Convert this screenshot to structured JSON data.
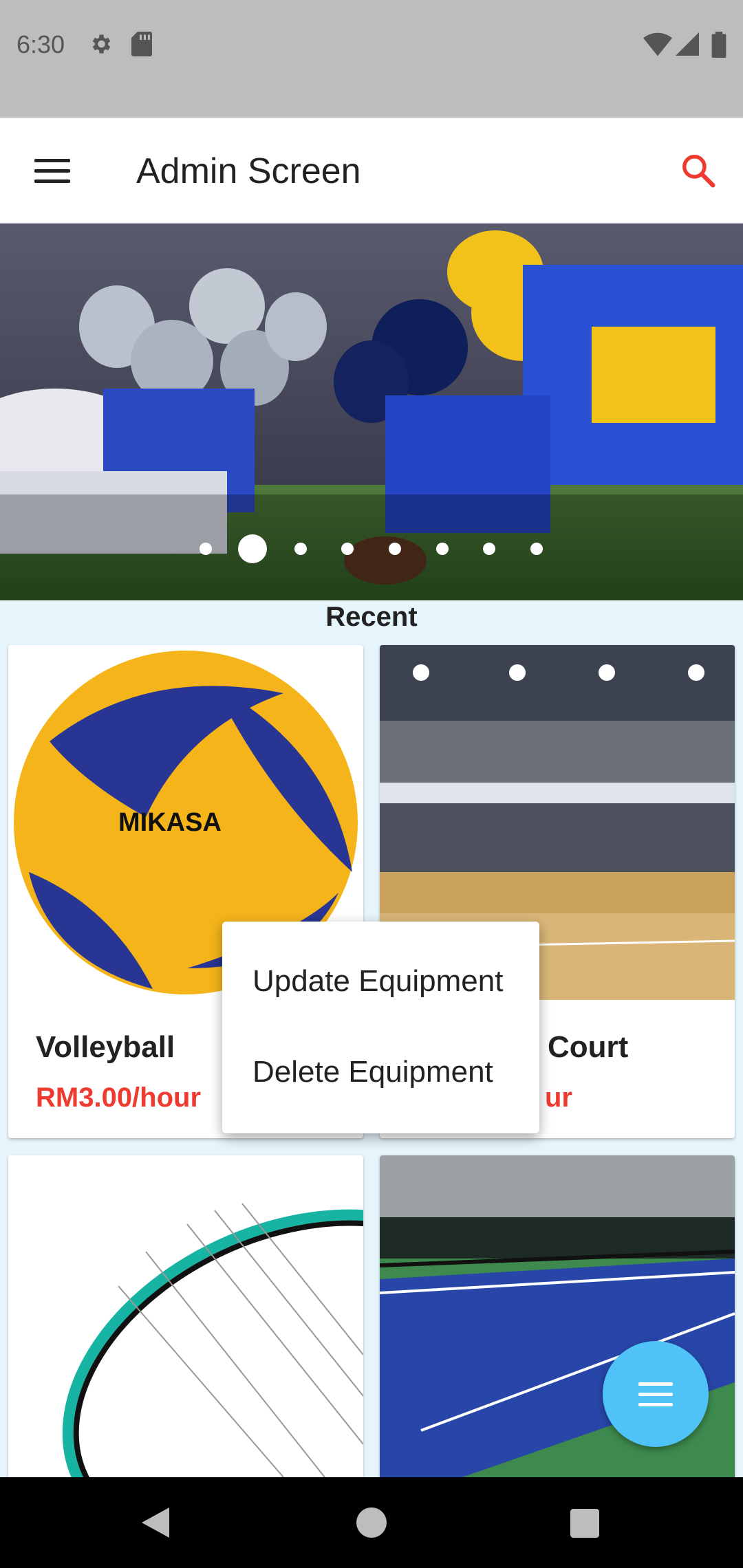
{
  "status_bar": {
    "time": "6:30"
  },
  "app_bar": {
    "title": "Admin Screen"
  },
  "banner": {
    "slide_count": 8,
    "active_index": 1
  },
  "section": {
    "title": "Recent"
  },
  "cards": [
    {
      "name": "Volleyball",
      "price": "RM3.00/hour"
    },
    {
      "name": "Court",
      "price": "ur"
    },
    {
      "name": "",
      "price": ""
    },
    {
      "name": "",
      "price": ""
    }
  ],
  "context_menu": {
    "items": [
      {
        "label": "Update Equipment"
      },
      {
        "label": "Delete Equipment"
      }
    ]
  },
  "colors": {
    "accent": "#ee3a2f",
    "fab": "#4fc3f7",
    "app_bar": "#ffffff",
    "status_bar": "#bdbdbd"
  }
}
